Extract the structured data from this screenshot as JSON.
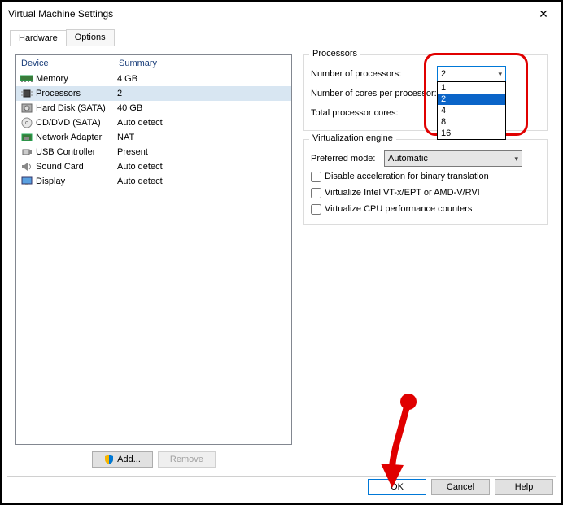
{
  "window": {
    "title": "Virtual Machine Settings",
    "close_glyph": "✕"
  },
  "tabs": {
    "hardware": "Hardware",
    "options": "Options",
    "active": "hardware"
  },
  "device_list": {
    "header_device": "Device",
    "header_summary": "Summary",
    "rows": [
      {
        "icon": "memory-icon",
        "device": "Memory",
        "summary": "4 GB"
      },
      {
        "icon": "cpu-icon",
        "device": "Processors",
        "summary": "2",
        "selected": true
      },
      {
        "icon": "hdd-icon",
        "device": "Hard Disk (SATA)",
        "summary": "40 GB"
      },
      {
        "icon": "cd-icon",
        "device": "CD/DVD (SATA)",
        "summary": "Auto detect"
      },
      {
        "icon": "nic-icon",
        "device": "Network Adapter",
        "summary": "NAT"
      },
      {
        "icon": "usb-icon",
        "device": "USB Controller",
        "summary": "Present"
      },
      {
        "icon": "sound-icon",
        "device": "Sound Card",
        "summary": "Auto detect"
      },
      {
        "icon": "display-icon",
        "device": "Display",
        "summary": "Auto detect"
      }
    ],
    "add_button": "Add...",
    "remove_button": "Remove"
  },
  "processors_group": {
    "title": "Processors",
    "num_proc_label": "Number of processors:",
    "num_proc_value": "2",
    "num_proc_options": [
      "1",
      "2",
      "4",
      "8",
      "16"
    ],
    "cores_label": "Number of cores per processor:",
    "total_label": "Total processor cores:"
  },
  "virt_group": {
    "title": "Virtualization engine",
    "mode_label": "Preferred mode:",
    "mode_value": "Automatic",
    "chk_disable_accel": "Disable acceleration for binary translation",
    "chk_vtx": "Virtualize Intel VT-x/EPT or AMD-V/RVI",
    "chk_counters": "Virtualize CPU performance counters"
  },
  "buttons": {
    "ok": "OK",
    "cancel": "Cancel",
    "help": "Help"
  }
}
